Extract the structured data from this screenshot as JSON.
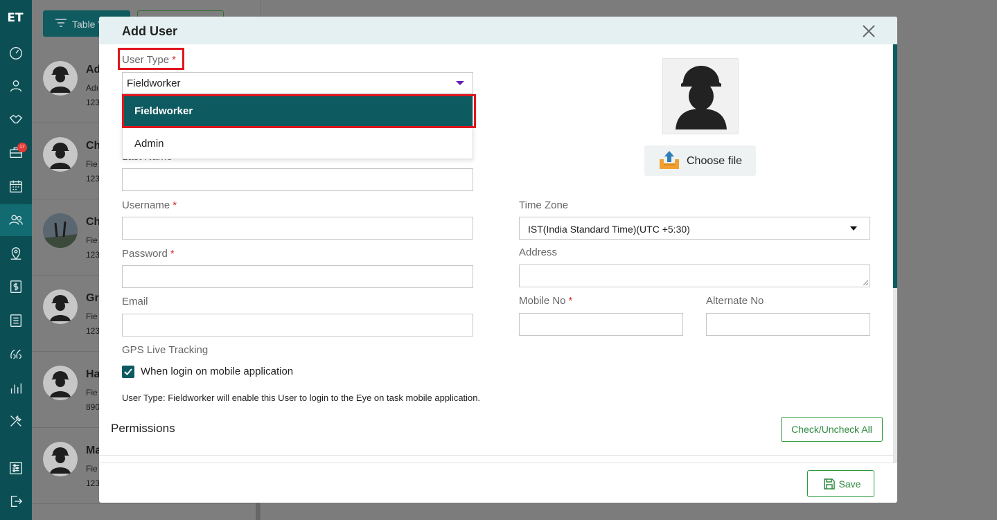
{
  "sidebar": {
    "logo": "ET",
    "badge_count": "17"
  },
  "list": {
    "table_view_label": "Table V",
    "rows": [
      {
        "name": "Ad",
        "sub1": "Adı",
        "sub2": "123"
      },
      {
        "name": "Ch",
        "sub1": "Fie",
        "sub2": "123"
      },
      {
        "name": "Ch",
        "sub1": "Fie",
        "sub2": "123"
      },
      {
        "name": "Gr",
        "sub1": "Fie",
        "sub2": "123"
      },
      {
        "name": "Ha",
        "sub1": "Fie",
        "sub2": "890"
      },
      {
        "name": "Ma",
        "sub1": "Fie",
        "sub2": "123"
      }
    ]
  },
  "modal": {
    "title": "Add User",
    "user_type": {
      "label": "User Type",
      "required": "*",
      "value": "Fieldworker",
      "options": [
        "Fieldworker",
        "Admin"
      ]
    },
    "last_name": {
      "label": "Last Name",
      "value": ""
    },
    "username": {
      "label": "Username",
      "required": "*",
      "value": ""
    },
    "password": {
      "label": "Password",
      "required": "*",
      "value": ""
    },
    "email": {
      "label": "Email",
      "value": ""
    },
    "gps": {
      "label": "GPS Live Tracking",
      "checkbox_label": "When login on mobile application",
      "checked": true
    },
    "note": "User Type: Fieldworker will enable this User to login to the Eye on task mobile application.",
    "photo": {
      "choose_file_label": "Choose file"
    },
    "time_zone": {
      "label": "Time Zone",
      "value": "IST(India Standard Time)(UTC +5:30)"
    },
    "address": {
      "label": "Address",
      "value": ""
    },
    "mobile_no": {
      "label": "Mobile No",
      "required": "*",
      "value": ""
    },
    "alternate_no": {
      "label": "Alternate No",
      "value": ""
    },
    "permissions": {
      "title": "Permissions",
      "check_all_label": "Check/Uncheck All"
    },
    "save_label": "Save"
  },
  "colors": {
    "sidebar_bg": "#0b4f55",
    "primary": "#0d5a60",
    "highlight_red": "#e0161d",
    "success_green": "#2e8a3e",
    "required_red": "#d32f2f"
  }
}
